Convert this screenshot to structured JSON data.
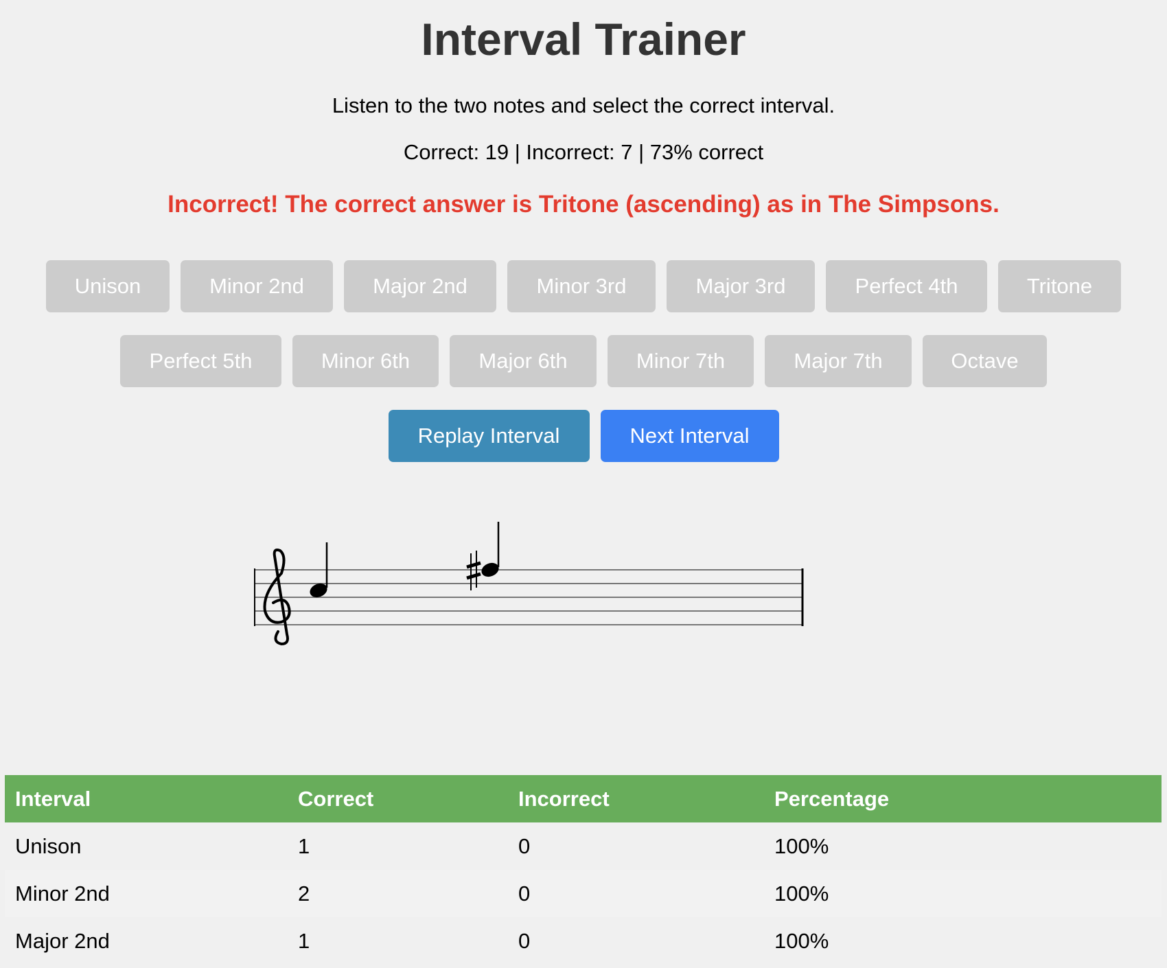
{
  "header": {
    "title": "Interval Trainer",
    "instructions": "Listen to the two notes and select the correct interval.",
    "stats": "Correct: 19 | Incorrect: 7 | 73% correct",
    "feedback": "Incorrect! The correct answer is Tritone (ascending) as in The Simpsons."
  },
  "intervals_row1": [
    "Unison",
    "Minor 2nd",
    "Major 2nd",
    "Minor 3rd",
    "Major 3rd",
    "Perfect 4th",
    "Tritone"
  ],
  "intervals_row2": [
    "Perfect 5th",
    "Minor 6th",
    "Major 6th",
    "Minor 7th",
    "Major 7th",
    "Octave"
  ],
  "actions": {
    "replay_label": "Replay Interval",
    "next_label": "Next Interval"
  },
  "notation": {
    "clef": "treble-clef",
    "notes": [
      {
        "pitch": "C5",
        "accidental": ""
      },
      {
        "pitch": "F#5",
        "accidental": "sharp"
      }
    ]
  },
  "stats_table": {
    "headers": [
      "Interval",
      "Correct",
      "Incorrect",
      "Percentage"
    ],
    "rows": [
      [
        "Unison",
        "1",
        "0",
        "100%"
      ],
      [
        "Minor 2nd",
        "2",
        "0",
        "100%"
      ],
      [
        "Major 2nd",
        "1",
        "0",
        "100%"
      ]
    ]
  },
  "colors": {
    "feedback_error": "#e33b2e",
    "interval_button": "#cccccc",
    "replay_button": "#3d8bb7",
    "next_button": "#3a80f3",
    "table_header": "#68ad5b"
  }
}
